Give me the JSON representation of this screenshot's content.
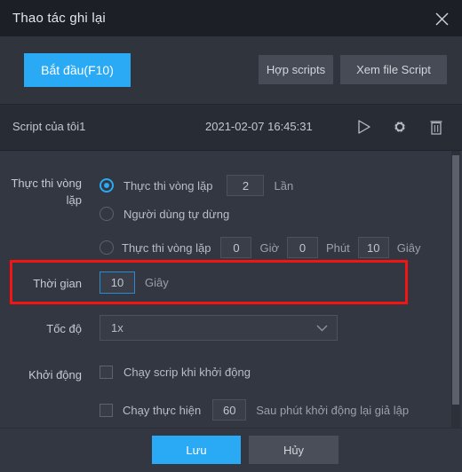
{
  "window": {
    "title": "Thao tác ghi lại",
    "close_icon": "close-icon"
  },
  "toolbar": {
    "start_label": "Bắt đầu(F10)",
    "merge_scripts_label": "Hợp scripts",
    "view_script_file_label": "Xem file Script"
  },
  "script_row": {
    "name": "Script của tôi1",
    "datetime": "2021-02-07 16:45:31",
    "play_icon": "play-icon",
    "settings_icon": "gear-icon",
    "delete_icon": "trash-icon"
  },
  "form": {
    "loop_section_label": "Thực thi vòng lặp",
    "options": {
      "loop_count": {
        "label": "Thực thi vòng lặp",
        "selected": true,
        "value": "2",
        "unit": "Lần"
      },
      "user_stop": {
        "label": "Người dùng tự dừng",
        "selected": false
      },
      "loop_duration": {
        "label": "Thực thi vòng lặp",
        "selected": false,
        "hours": "0",
        "hours_unit": "Giờ",
        "minutes": "0",
        "minutes_unit": "Phút",
        "seconds": "10",
        "seconds_unit": "Giây"
      }
    },
    "time": {
      "label": "Thời gian",
      "value": "10",
      "unit": "Giây"
    },
    "speed": {
      "label": "Tốc độ",
      "value": "1x",
      "chevron_icon": "chevron-down-icon"
    },
    "startup": {
      "label": "Khởi động",
      "run_on_boot": {
        "label": "Chạy scrip khi khởi động",
        "checked": false
      },
      "run_after_restart": {
        "label": "Chạy thực hiện",
        "checked": false,
        "value": "60",
        "suffix": "Sau phút khởi động lại giả lập"
      }
    }
  },
  "footer": {
    "save_label": "Lưu",
    "cancel_label": "Hủy"
  },
  "colors": {
    "accent": "#2aa9f4",
    "highlight": "#f51414",
    "window_bg": "#333741",
    "titlebar_bg": "#1c1f26"
  }
}
